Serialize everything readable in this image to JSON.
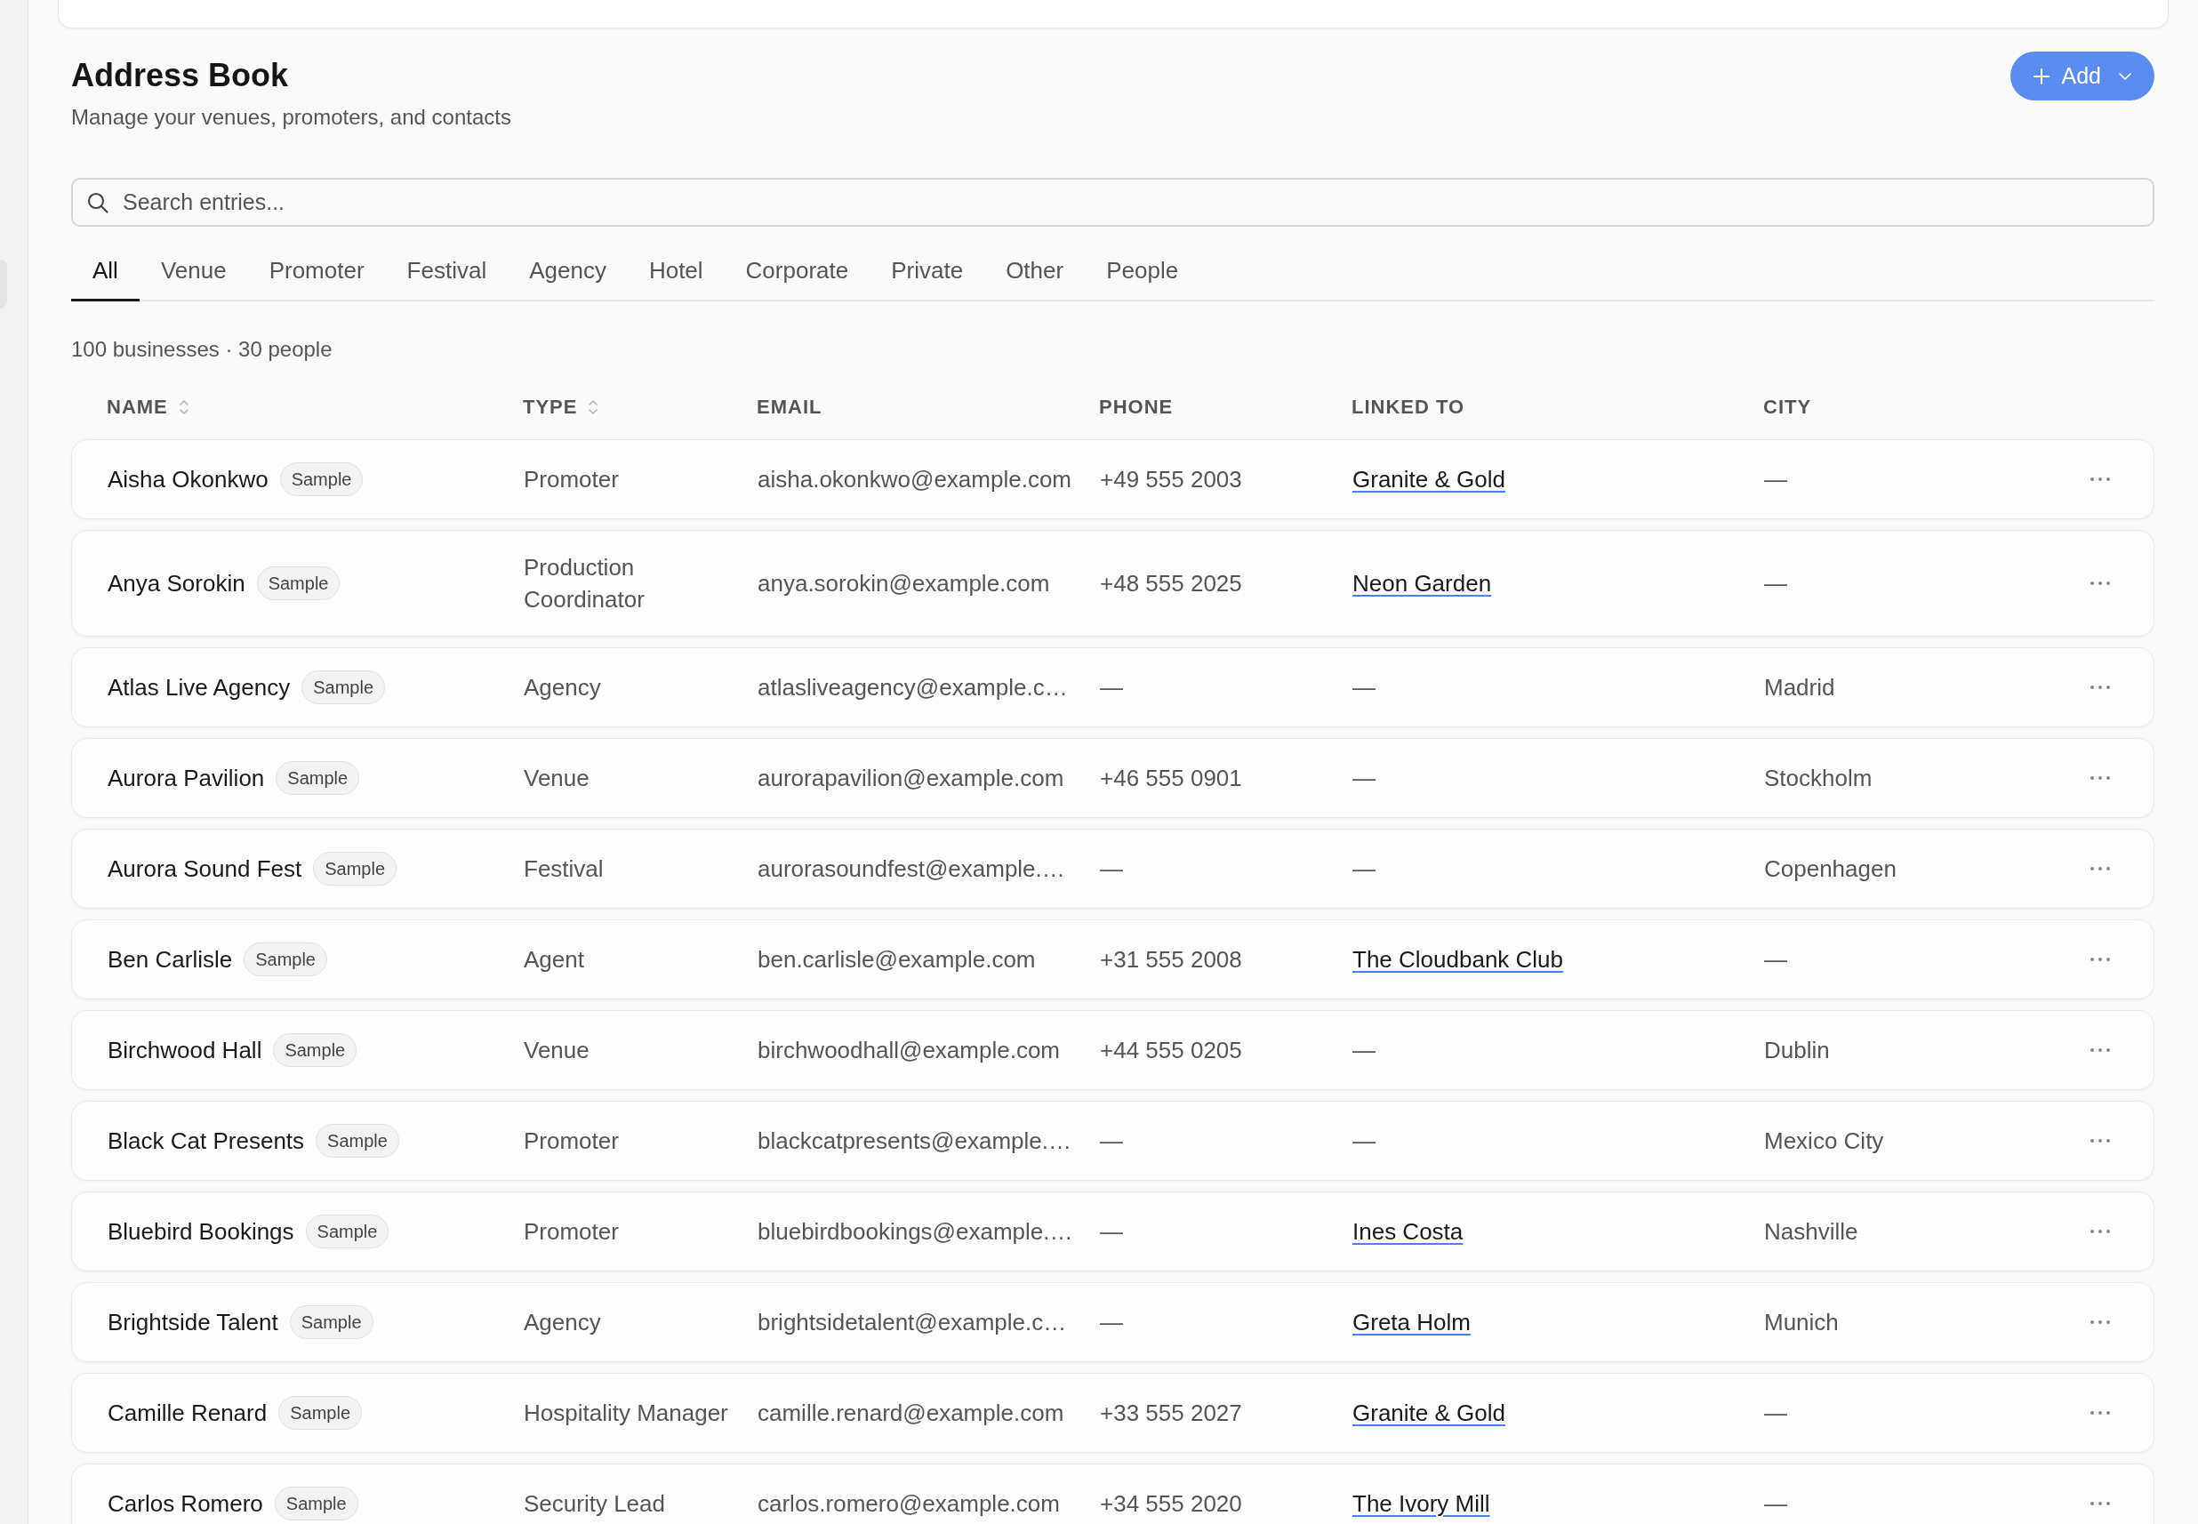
{
  "header": {
    "title": "Address Book",
    "subtitle": "Manage your venues, promoters, and contacts",
    "add_button": {
      "label": "Add"
    }
  },
  "search": {
    "placeholder": "Search entries..."
  },
  "tabs": [
    {
      "label": "All",
      "selected": true
    },
    {
      "label": "Venue",
      "selected": false
    },
    {
      "label": "Promoter",
      "selected": false
    },
    {
      "label": "Festival",
      "selected": false
    },
    {
      "label": "Agency",
      "selected": false
    },
    {
      "label": "Hotel",
      "selected": false
    },
    {
      "label": "Corporate",
      "selected": false
    },
    {
      "label": "Private",
      "selected": false
    },
    {
      "label": "Other",
      "selected": false
    },
    {
      "label": "People",
      "selected": false
    }
  ],
  "summary": "100 businesses · 30 people",
  "table": {
    "columns": [
      {
        "label": "NAME",
        "sortable": true
      },
      {
        "label": "TYPE",
        "sortable": true
      },
      {
        "label": "EMAIL",
        "sortable": false
      },
      {
        "label": "PHONE",
        "sortable": false
      },
      {
        "label": "LINKED TO",
        "sortable": false
      },
      {
        "label": "CITY",
        "sortable": false
      }
    ],
    "rows": [
      {
        "name": "Aisha Okonkwo",
        "badge": "Sample",
        "type": "Promoter",
        "email": "aisha.okonkwo@example.com",
        "phone": "+49 555 2003",
        "linked_to": {
          "kind": "link",
          "text": "Granite & Gold"
        },
        "city": "—"
      },
      {
        "name": "Anya Sorokin",
        "badge": "Sample",
        "type": "Production Coordinator",
        "email": "anya.sorokin@example.com",
        "phone": "+48 555 2025",
        "linked_to": {
          "kind": "link",
          "text": "Neon Garden"
        },
        "city": "—"
      },
      {
        "name": "Atlas Live Agency",
        "badge": "Sample",
        "type": "Agency",
        "email": "atlasliveagency@example.c…",
        "phone": "—",
        "linked_to": {
          "kind": "none",
          "text": "—"
        },
        "city": "Madrid"
      },
      {
        "name": "Aurora Pavilion",
        "badge": "Sample",
        "type": "Venue",
        "email": "aurorapavilion@example.com",
        "phone": "+46 555 0901",
        "linked_to": {
          "kind": "none",
          "text": "—"
        },
        "city": "Stockholm"
      },
      {
        "name": "Aurora Sound Fest",
        "badge": "Sample",
        "type": "Festival",
        "email": "aurorasoundfest@example.…",
        "phone": "—",
        "linked_to": {
          "kind": "none",
          "text": "—"
        },
        "city": "Copenhagen"
      },
      {
        "name": "Ben Carlisle",
        "badge": "Sample",
        "type": "Agent",
        "email": "ben.carlisle@example.com",
        "phone": "+31 555 2008",
        "linked_to": {
          "kind": "link",
          "text": "The Cloudbank Club"
        },
        "city": "—"
      },
      {
        "name": "Birchwood Hall",
        "badge": "Sample",
        "type": "Venue",
        "email": "birchwoodhall@example.com",
        "phone": "+44 555 0205",
        "linked_to": {
          "kind": "none",
          "text": "—"
        },
        "city": "Dublin"
      },
      {
        "name": "Black Cat Presents",
        "badge": "Sample",
        "type": "Promoter",
        "email": "blackcatpresents@example.…",
        "phone": "—",
        "linked_to": {
          "kind": "none",
          "text": "—"
        },
        "city": "Mexico City"
      },
      {
        "name": "Bluebird Bookings",
        "badge": "Sample",
        "type": "Promoter",
        "email": "bluebirdbookings@example.…",
        "phone": "—",
        "linked_to": {
          "kind": "link",
          "text": "Ines Costa"
        },
        "city": "Nashville"
      },
      {
        "name": "Brightside Talent",
        "badge": "Sample",
        "type": "Agency",
        "email": "brightsidetalent@example.c…",
        "phone": "—",
        "linked_to": {
          "kind": "link",
          "text": "Greta Holm"
        },
        "city": "Munich"
      },
      {
        "name": "Camille Renard",
        "badge": "Sample",
        "type": "Hospitality Manager",
        "email": "camille.renard@example.com",
        "phone": "+33 555 2027",
        "linked_to": {
          "kind": "link",
          "text": "Granite & Gold"
        },
        "city": "—"
      },
      {
        "name": "Carlos Romero",
        "badge": "Sample",
        "type": "Security Lead",
        "email": "carlos.romero@example.com",
        "phone": "+34 555 2020",
        "linked_to": {
          "kind": "link",
          "text": "The Ivory Mill"
        },
        "city": "—"
      }
    ]
  }
}
